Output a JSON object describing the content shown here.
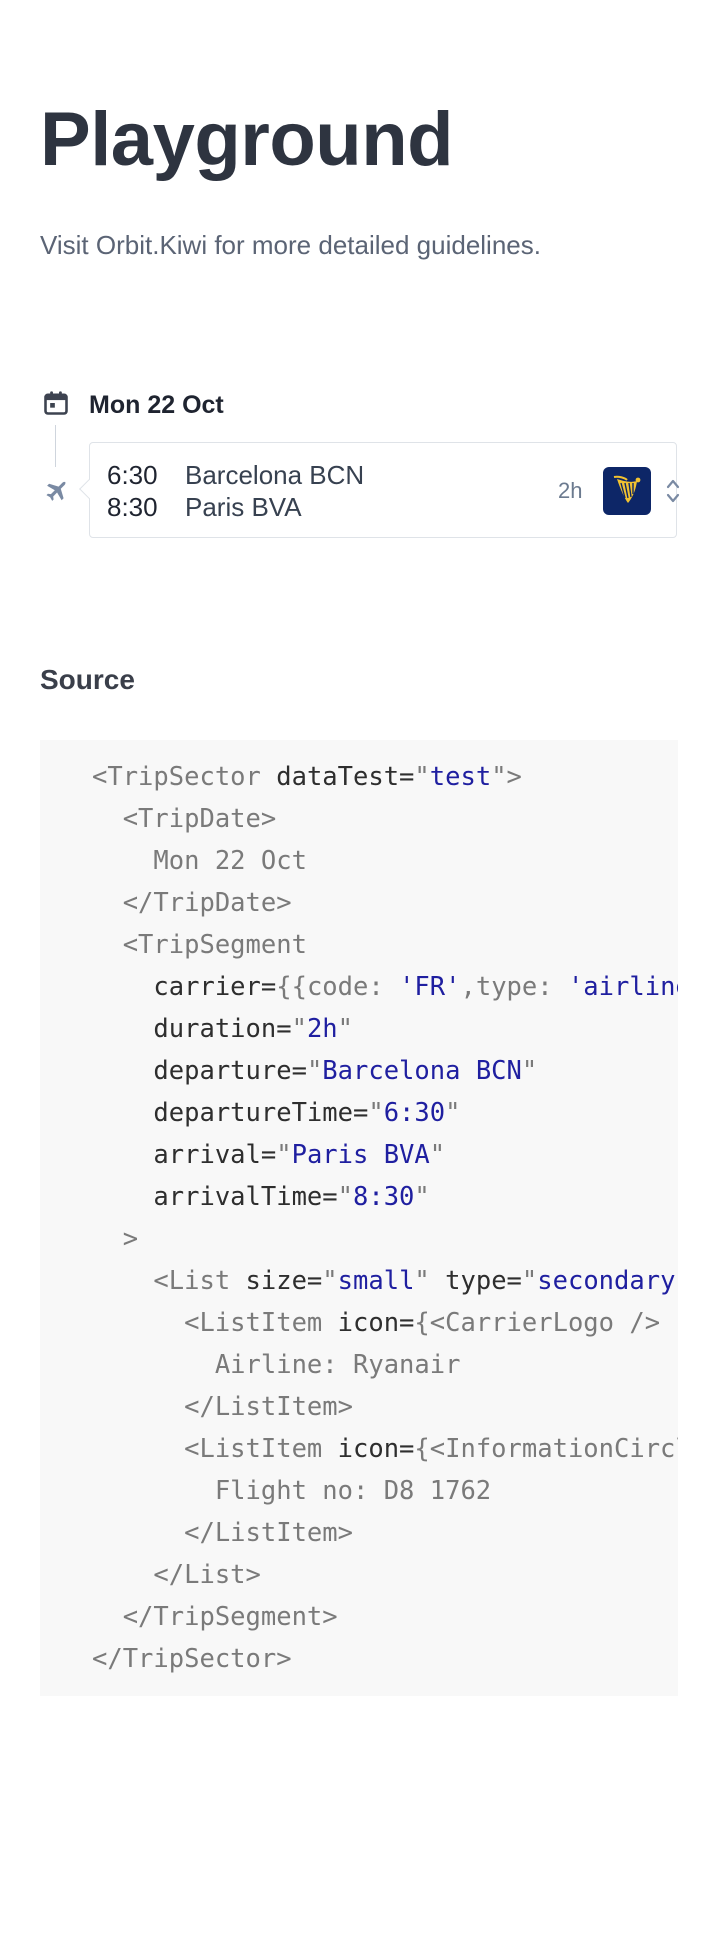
{
  "page": {
    "title": "Playground",
    "subtitle": "Visit Orbit.Kiwi for more detailed guidelines."
  },
  "trip": {
    "date": "Mon 22 Oct",
    "segment": {
      "departure_time": "6:30",
      "departure": "Barcelona BCN",
      "arrival_time": "8:30",
      "arrival": "Paris BVA",
      "duration": "2h",
      "carrier_logo_icon": "ryanair-harp-logo",
      "expand_icon": "chevron-up-down-icon"
    },
    "icons": {
      "date": "calendar-icon",
      "segment": "airplane-icon"
    }
  },
  "source": {
    "heading": "Source",
    "lines": [
      [
        {
          "t": "tag",
          "v": "<TripSector"
        },
        {
          "t": "attr",
          "v": " dataTest="
        },
        {
          "t": "punc",
          "v": "\""
        },
        {
          "t": "str",
          "v": "test"
        },
        {
          "t": "punc",
          "v": "\">"
        }
      ],
      [
        {
          "t": "tag",
          "v": "  <TripDate>"
        }
      ],
      [
        {
          "t": "text",
          "v": "    Mon 22 Oct"
        }
      ],
      [
        {
          "t": "tag",
          "v": "  </TripDate>"
        }
      ],
      [
        {
          "t": "tag",
          "v": "  <TripSegment"
        }
      ],
      [
        {
          "t": "attr",
          "v": "    carrier="
        },
        {
          "t": "punc",
          "v": "{{code: "
        },
        {
          "t": "str",
          "v": "'FR'"
        },
        {
          "t": "punc",
          "v": ",type: "
        },
        {
          "t": "str",
          "v": "'airline'"
        }
      ],
      [
        {
          "t": "attr",
          "v": "    duration="
        },
        {
          "t": "punc",
          "v": "\""
        },
        {
          "t": "str",
          "v": "2h"
        },
        {
          "t": "punc",
          "v": "\""
        }
      ],
      [
        {
          "t": "attr",
          "v": "    departure="
        },
        {
          "t": "punc",
          "v": "\""
        },
        {
          "t": "str",
          "v": "Barcelona BCN"
        },
        {
          "t": "punc",
          "v": "\""
        }
      ],
      [
        {
          "t": "attr",
          "v": "    departureTime="
        },
        {
          "t": "punc",
          "v": "\""
        },
        {
          "t": "str",
          "v": "6:30"
        },
        {
          "t": "punc",
          "v": "\""
        }
      ],
      [
        {
          "t": "attr",
          "v": "    arrival="
        },
        {
          "t": "punc",
          "v": "\""
        },
        {
          "t": "str",
          "v": "Paris BVA"
        },
        {
          "t": "punc",
          "v": "\""
        }
      ],
      [
        {
          "t": "attr",
          "v": "    arrivalTime="
        },
        {
          "t": "punc",
          "v": "\""
        },
        {
          "t": "str",
          "v": "8:30"
        },
        {
          "t": "punc",
          "v": "\""
        }
      ],
      [
        {
          "t": "tag",
          "v": "  >"
        }
      ],
      [
        {
          "t": "tag",
          "v": "    <List"
        },
        {
          "t": "attr",
          "v": " size="
        },
        {
          "t": "punc",
          "v": "\""
        },
        {
          "t": "str",
          "v": "small"
        },
        {
          "t": "punc",
          "v": "\""
        },
        {
          "t": "attr",
          "v": " type="
        },
        {
          "t": "punc",
          "v": "\""
        },
        {
          "t": "str",
          "v": "secondary"
        }
      ],
      [
        {
          "t": "tag",
          "v": "      <ListItem"
        },
        {
          "t": "attr",
          "v": " icon="
        },
        {
          "t": "punc",
          "v": "{<CarrierLogo />"
        }
      ],
      [
        {
          "t": "text",
          "v": "        Airline: Ryanair"
        }
      ],
      [
        {
          "t": "tag",
          "v": "      </ListItem>"
        }
      ],
      [
        {
          "t": "tag",
          "v": "      <ListItem"
        },
        {
          "t": "attr",
          "v": " icon="
        },
        {
          "t": "punc",
          "v": "{<InformationCircle"
        }
      ],
      [
        {
          "t": "text",
          "v": "        Flight no: D8 1762"
        }
      ],
      [
        {
          "t": "tag",
          "v": "      </ListItem>"
        }
      ],
      [
        {
          "t": "tag",
          "v": "    </List>"
        }
      ],
      [
        {
          "t": "tag",
          "v": "  </TripSegment>"
        }
      ],
      [
        {
          "t": "tag",
          "v": "</TripSector>"
        }
      ]
    ]
  }
}
